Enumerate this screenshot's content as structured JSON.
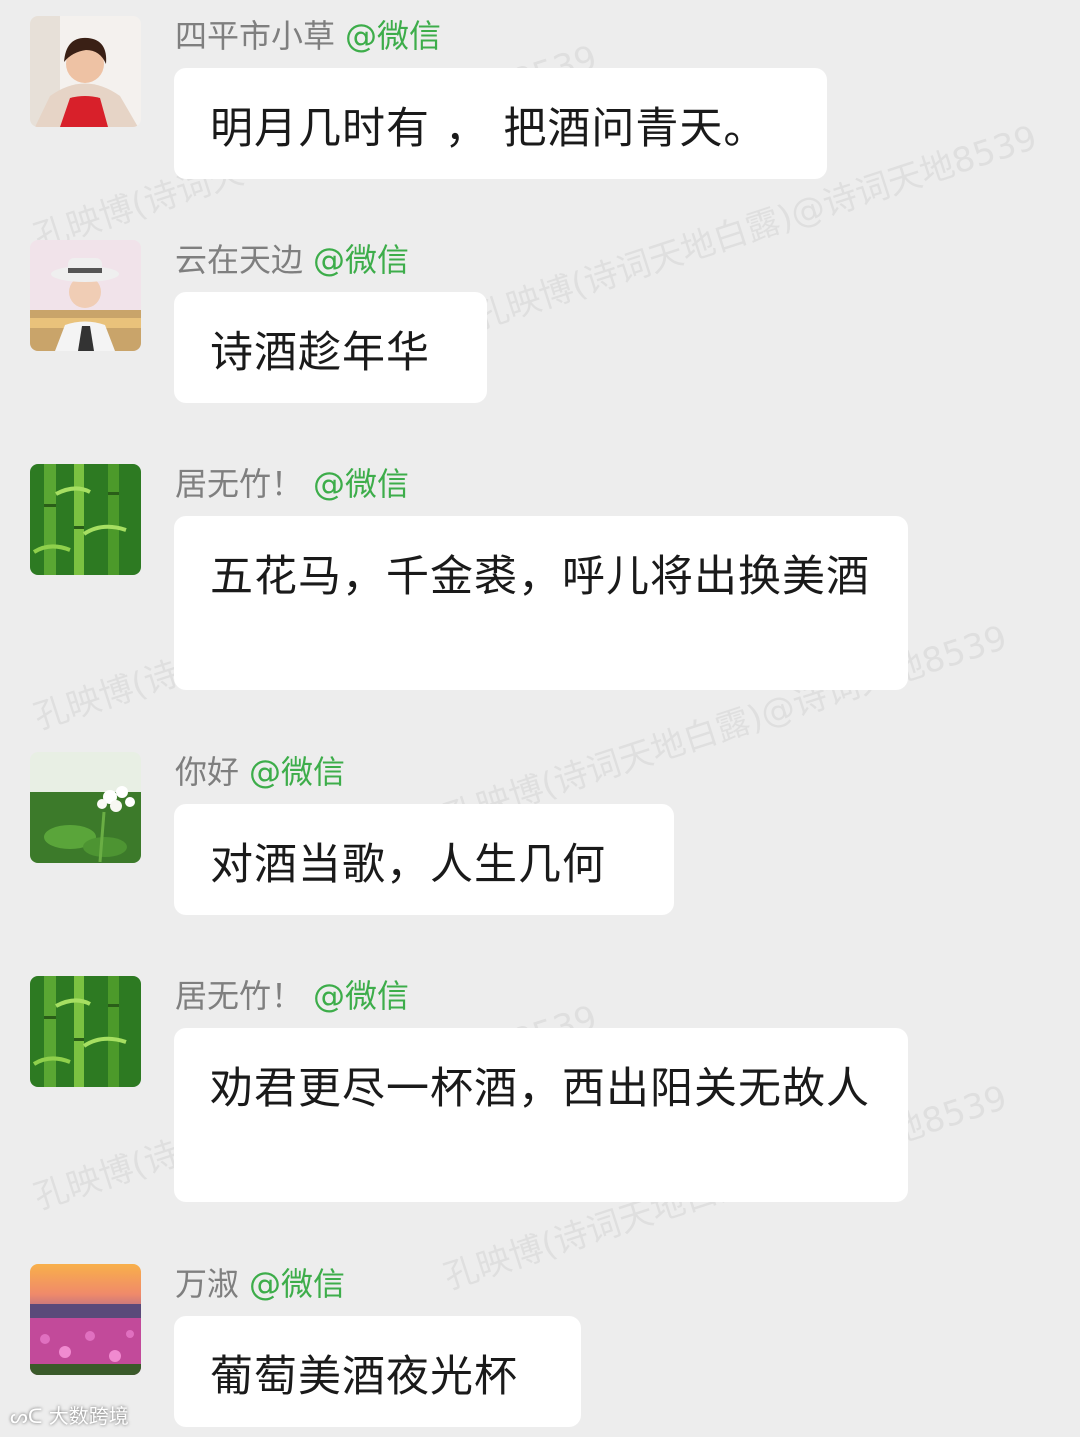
{
  "messages": [
    {
      "name": "四平市小草",
      "tag": "@微信",
      "text": "明月几时有 ， 把酒问青天。"
    },
    {
      "name": "云在天边",
      "tag": "@微信",
      "text": "诗酒趁年华"
    },
    {
      "name": "居无竹！",
      "tag": "@微信",
      "text": "五花马，千金裘，呼儿将出换美酒"
    },
    {
      "name": "你好",
      "tag": "@微信",
      "text": "对酒当歌，人生几何"
    },
    {
      "name": "居无竹！",
      "tag": "@微信",
      "text": "劝君更尽一杯酒，西出阳关无故人"
    },
    {
      "name": "万淑",
      "tag": "@微信",
      "text": "葡萄美酒夜光杯"
    }
  ],
  "watermarks": [
    "孔映博(诗词天地白露)@诗词天地8539"
  ],
  "footer_logo": "大数跨境",
  "colors": {
    "background": "#ededed",
    "bubble": "#ffffff",
    "sender_name": "#7f7f7f",
    "sender_tag": "#3dad4a"
  },
  "avatars": [
    "woman-red-sweater",
    "woman-white-hat",
    "bamboo",
    "white-flower",
    "bamboo",
    "sunset-flower-field"
  ]
}
